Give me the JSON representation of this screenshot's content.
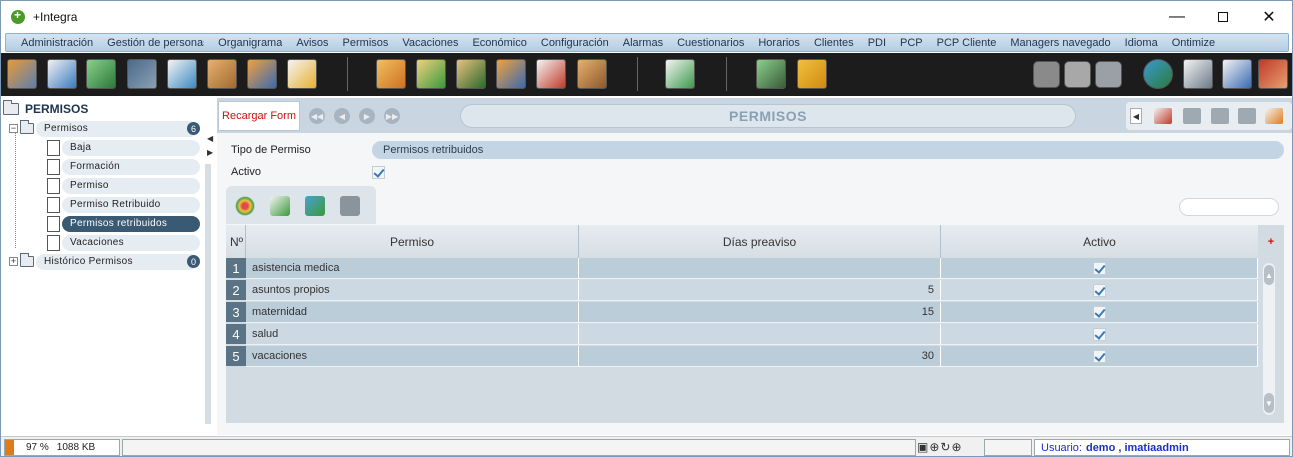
{
  "window": {
    "title": "+Integra"
  },
  "menu": [
    "Administración",
    "Gestión de personas",
    "Organigrama",
    "Avisos",
    "Permisos",
    "Vacaciones",
    "Económico",
    "Configuración",
    "Alarmas",
    "Cuestionarios",
    "Horarios",
    "Clientes",
    "PDI",
    "PCP",
    "PCP Cliente",
    "Managers navegado",
    "Idioma",
    "Ontimize"
  ],
  "sidebar": {
    "title": "PERMISOS",
    "group": {
      "label": "Permisos",
      "count": "6"
    },
    "items": [
      "Baja",
      "Formación",
      "Permiso",
      "Permiso Retribuido",
      "Permisos retribuidos",
      "Vacaciones"
    ],
    "selected": "Permisos retribuidos",
    "history": {
      "label": "Histórico Permisos",
      "count": "0"
    }
  },
  "form": {
    "reload_label": "Recargar Form",
    "title": "PERMISOS",
    "tipo_label": "Tipo de Permiso",
    "tipo_value": "Permisos retribuidos",
    "activo_label": "Activo",
    "activo_checked": true
  },
  "grid": {
    "columns": [
      "Nº",
      "Permiso",
      "Días preaviso",
      "Activo"
    ],
    "add_symbol": "+",
    "rows": [
      {
        "n": "1",
        "permiso": "asistencia medica",
        "dias": "",
        "activo": true
      },
      {
        "n": "2",
        "permiso": "asuntos propios",
        "dias": "5",
        "activo": true
      },
      {
        "n": "3",
        "permiso": "maternidad",
        "dias": "15",
        "activo": true
      },
      {
        "n": "4",
        "permiso": "salud",
        "dias": "",
        "activo": true
      },
      {
        "n": "5",
        "permiso": "vacaciones",
        "dias": "30",
        "activo": true
      }
    ]
  },
  "status": {
    "memory_percent": "97 %",
    "memory_kb": "1088 KB",
    "user_label": "Usuario:",
    "user_value": "demo , imatiaadmin"
  },
  "colors": {
    "accent": "#3a5a74",
    "reload_text": "#cc1111",
    "user_text": "#1a2fc4",
    "memory_bar": "#e07b1a"
  },
  "toolbar_icons": [
    "employees-icon",
    "notepad-icon",
    "person-green-icon",
    "calendar-icon",
    "checklist-icon",
    "handshake-icon",
    "group-icon",
    "edit-note-icon",
    "documents-icon",
    "user-green-icon",
    "manager-icon",
    "team-icon",
    "id-card-icon",
    "agreement-icon",
    "mail-icon",
    "user-settings-icon",
    "email-at-icon",
    "back-icon",
    "stop-icon",
    "home-icon",
    "help-globe-icon",
    "calculator-icon",
    "lock-icon",
    "exit-door-icon"
  ]
}
